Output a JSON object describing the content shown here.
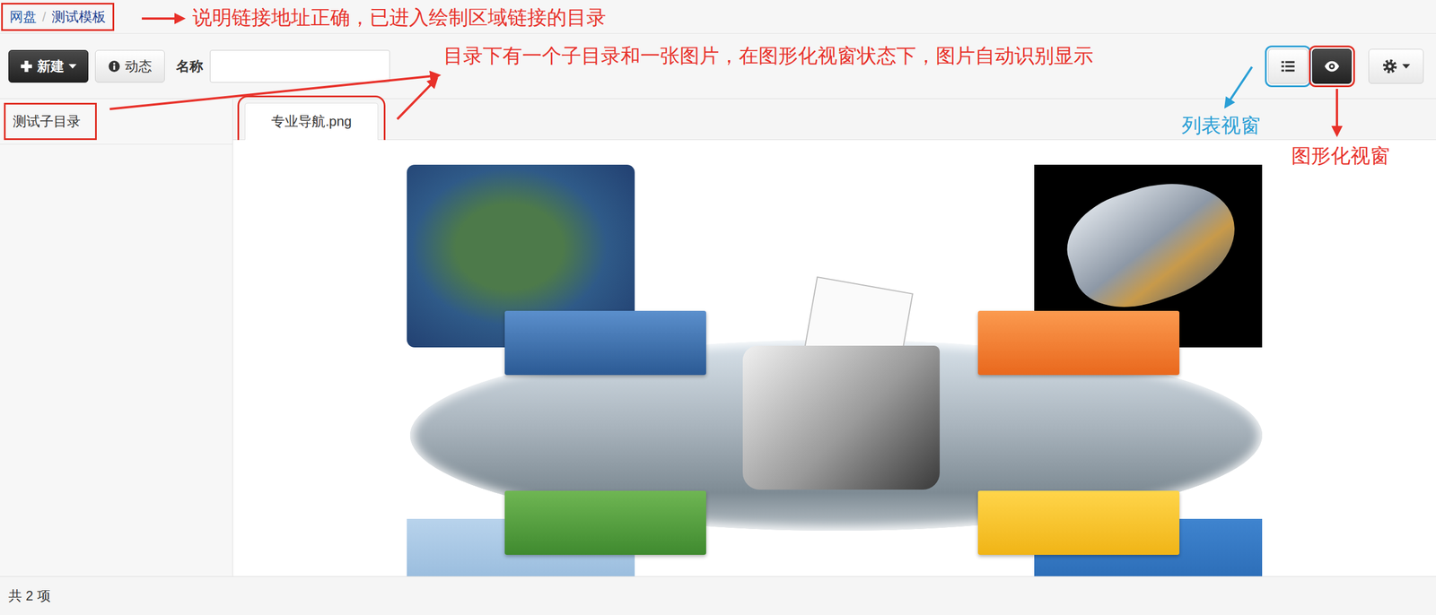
{
  "breadcrumb": {
    "separator": "/",
    "items": [
      {
        "label": "网盘",
        "selected": false
      },
      {
        "label": "测试模板",
        "selected": true
      }
    ]
  },
  "toolbar": {
    "new_button": {
      "label": "新建"
    },
    "activity_button": {
      "label": "动态"
    },
    "name_filter": {
      "label": "名称",
      "value": ""
    },
    "view_modes": [
      {
        "kind": "list",
        "selected": false
      },
      {
        "kind": "graphic",
        "selected": true
      }
    ]
  },
  "sidebar": {
    "items": [
      {
        "label": "测试子目录",
        "selected": false
      }
    ]
  },
  "tabs": [
    {
      "label": "专业导航.png",
      "selected": true
    }
  ],
  "status_bar": {
    "text": "共 2 项"
  },
  "annotations": [
    {
      "text": "说明链接地址正确，已进入绘制区域链接的目录",
      "color": "#e8312a"
    },
    {
      "text": "目录下有一个子目录和一张图片，在图形化视窗状态下，图片自动识别显示",
      "color": "#e8312a"
    },
    {
      "text": "列表视窗",
      "color": "#2a9fd6"
    },
    {
      "text": "图形化视窗",
      "color": "#e8312a"
    }
  ]
}
